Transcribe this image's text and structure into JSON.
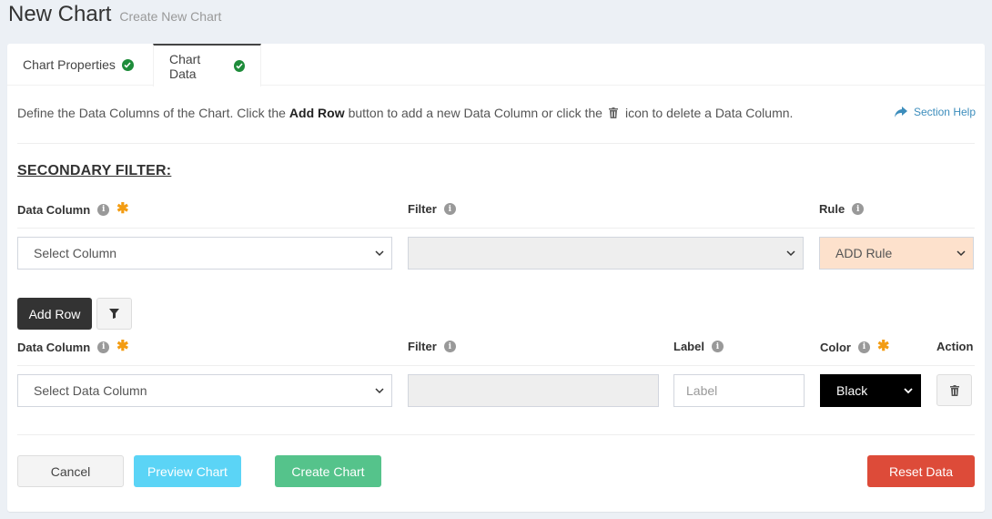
{
  "header": {
    "title": "New Chart",
    "subtitle": "Create New Chart"
  },
  "tabs": [
    {
      "label": "Chart Properties",
      "completed": true
    },
    {
      "label": "Chart Data",
      "completed": true,
      "active": true
    }
  ],
  "description": {
    "part1": "Define the Data Columns of the Chart. Click the",
    "bold": "Add Row",
    "part2": "button to add a new Data Column or click the",
    "part3": "icon to delete a Data Column."
  },
  "section_help": "Section Help",
  "secondary_filter": {
    "title": "SECONDARY FILTER:",
    "labels": {
      "data_column": "Data Column",
      "filter": "Filter",
      "rule": "Rule"
    },
    "data_column_value": "Select Column",
    "filter_value": "",
    "rule_value": "ADD Rule"
  },
  "buttons": {
    "add_row": "Add Row",
    "cancel": "Cancel",
    "preview": "Preview Chart",
    "create": "Create Chart",
    "reset": "Reset Data"
  },
  "data_table": {
    "headers": {
      "data_column": "Data Column",
      "filter": "Filter",
      "label": "Label",
      "color": "Color",
      "action": "Action"
    },
    "row": {
      "data_column": "Select Data Column",
      "filter": "",
      "label_placeholder": "Label",
      "color": "Black"
    }
  },
  "colors": {
    "accent": "#3c8dbc",
    "success": "#1e8c3a",
    "danger": "#dd4b39",
    "info": "#5bd4f6",
    "create": "#55c38b",
    "required": "#f39c12"
  }
}
